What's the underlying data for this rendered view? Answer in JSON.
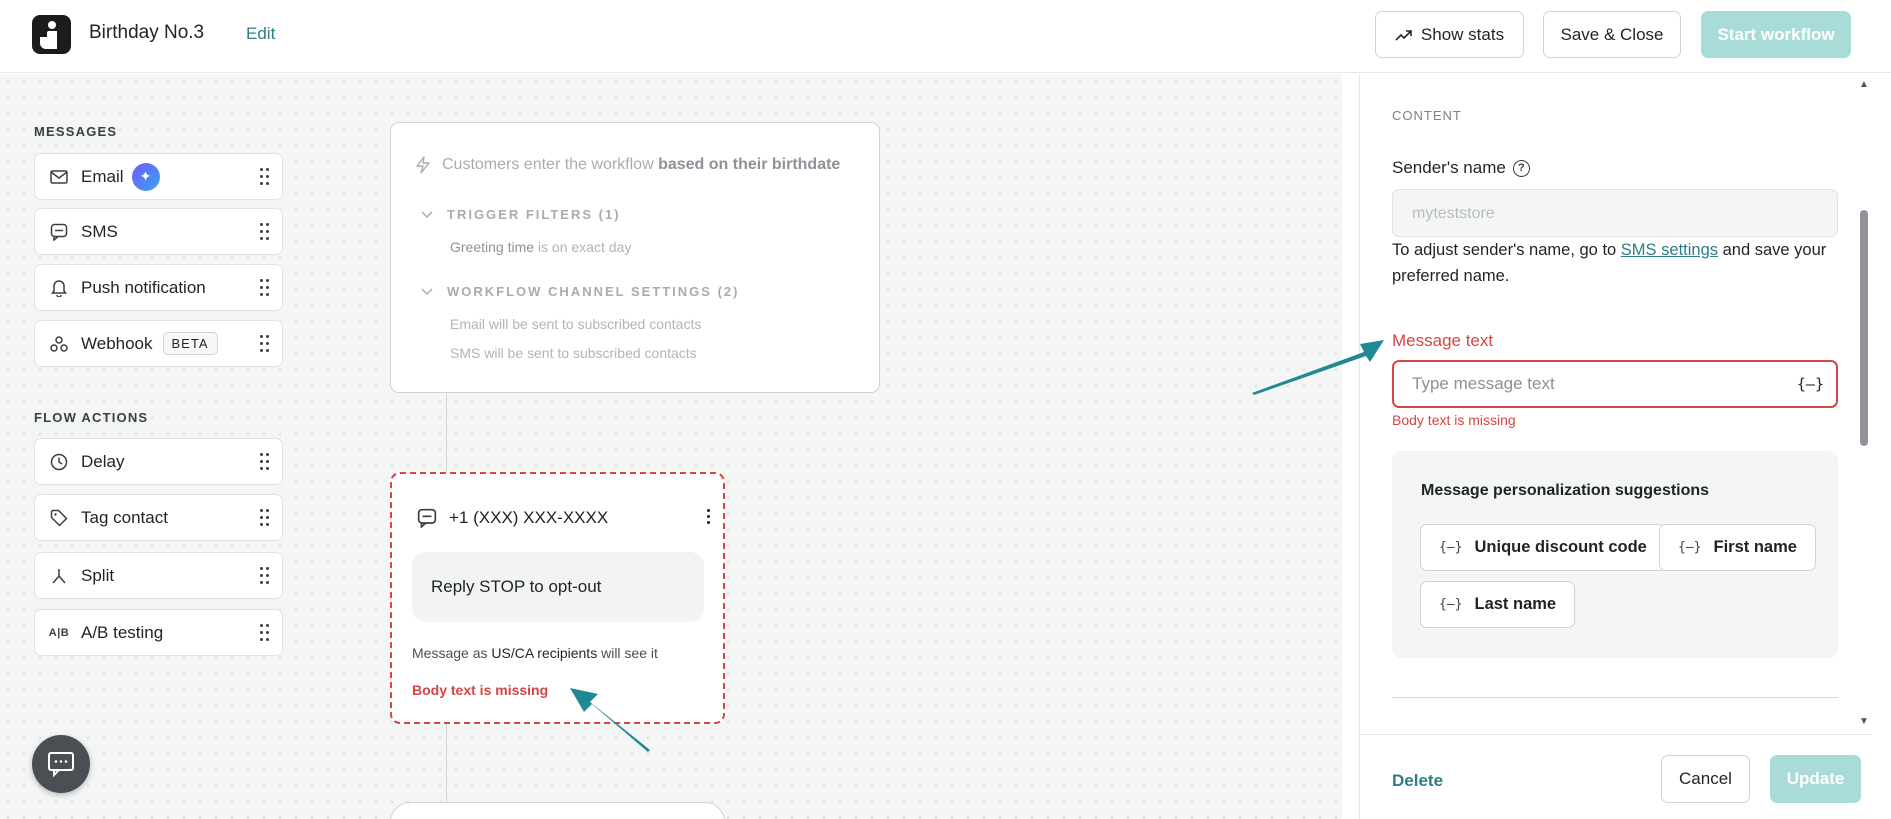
{
  "header": {
    "title": "Birthday No.3",
    "edit_label": "Edit",
    "show_stats_label": "Show stats",
    "save_close_label": "Save & Close",
    "start_workflow_label": "Start workflow"
  },
  "sidebar": {
    "messages_heading": "MESSAGES",
    "messages": [
      {
        "label": "Email",
        "icon": "mail-icon"
      },
      {
        "label": "SMS",
        "icon": "chat-bubble-icon"
      },
      {
        "label": "Push notification",
        "icon": "bell-icon"
      },
      {
        "label": "Webhook",
        "icon": "webhook-icon",
        "badge": "BETA"
      }
    ],
    "flow_heading": "FLOW ACTIONS",
    "flow_actions": [
      {
        "label": "Delay",
        "icon": "clock-icon"
      },
      {
        "label": "Tag contact",
        "icon": "tag-icon"
      },
      {
        "label": "Split",
        "icon": "split-icon"
      },
      {
        "label": "A/B testing",
        "icon": "ab-icon",
        "icon_text": "A|B"
      }
    ]
  },
  "trigger": {
    "text_prefix": "Customers enter the workflow ",
    "text_bold": "based on their birthdate",
    "filters_heading": "TRIGGER FILTERS (1)",
    "filter_key": "Greeting time",
    "filter_rest": " is on exact day",
    "channels_heading": "WORKFLOW CHANNEL SETTINGS (2)",
    "channel_lines": [
      "Email will be sent to subscribed contacts",
      "SMS will be sent to subscribed contacts"
    ]
  },
  "sms_node": {
    "phone": "+1 (XXX) XXX-XXXX",
    "bubble_text": "Reply STOP to opt-out",
    "message_as_prefix": "Message as ",
    "message_as_bold": "US/CA recipients",
    "message_as_suffix": " will see it",
    "error": "Body text is missing"
  },
  "panel": {
    "section": "CONTENT",
    "sender_label": "Sender's name",
    "sender_value": "myteststore",
    "help_prefix": "To adjust sender's name, go to ",
    "help_link": "SMS settings",
    "help_suffix": " and save your preferred name.",
    "message_label": "Message text",
    "message_placeholder": "Type message text",
    "message_var_icon": "{–}",
    "message_error": "Body text is missing",
    "suggestions_title": "Message personalization suggestions",
    "suggestion_icon": "{–}",
    "suggestions": [
      "Unique discount code",
      "First name",
      "Last name"
    ],
    "delete_label": "Delete",
    "cancel_label": "Cancel",
    "update_label": "Update"
  },
  "colors": {
    "accent": "#2b7f86",
    "disabled_primary": "#a9dcd9",
    "error": "#d64545",
    "annotation_arrow": "#1f8a93"
  }
}
